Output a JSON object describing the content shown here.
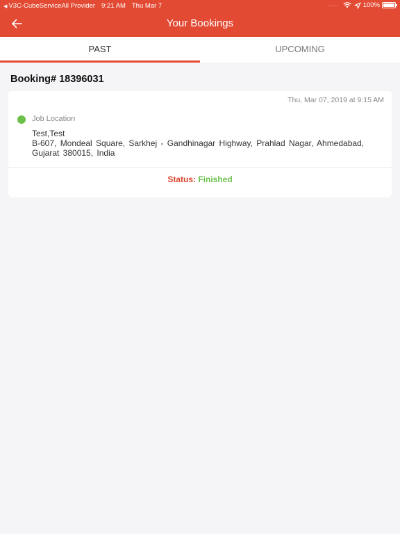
{
  "status_bar": {
    "carrier": "V3C-CubeServiceAll Provider",
    "time": "9:21 AM",
    "date": "Thu Mar 7",
    "battery": "100%"
  },
  "header": {
    "title": "Your Bookings",
    "back_icon": "arrow-left-icon"
  },
  "tabs": [
    {
      "label": "PAST",
      "active": true
    },
    {
      "label": "UPCOMING",
      "active": false
    }
  ],
  "booking": {
    "number": "Booking# 18396031",
    "datetime": "Thu, Mar 07, 2019 at 9:15 AM",
    "location_label": "Job Location",
    "location_name": "Test,Test",
    "address": "B-607, Mondeal Square, Sarkhej - Gandhinagar Highway, Prahlad Nagar, Ahmedabad, Gujarat 380015, India",
    "status_label": "Status:",
    "status_value": "Finished"
  },
  "colors": {
    "brand": "#e34a33",
    "status_finished": "#6cc04a",
    "background": "#f5f4f6"
  }
}
